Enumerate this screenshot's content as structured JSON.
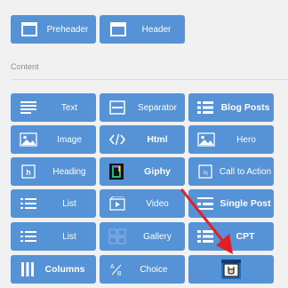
{
  "top_blocks": [
    {
      "label": "Preheader",
      "icon": "panel-icon"
    },
    {
      "label": "Header",
      "icon": "header-panel-icon"
    }
  ],
  "section": {
    "title": "Content"
  },
  "blocks": [
    {
      "label": "Text",
      "icon": "text-lines-icon"
    },
    {
      "label": "Separator",
      "icon": "separator-icon"
    },
    {
      "label": "Blog Posts",
      "icon": "blog-posts-icon"
    },
    {
      "label": "Image",
      "icon": "image-icon"
    },
    {
      "label": "Html",
      "icon": "code-icon"
    },
    {
      "label": "Hero",
      "icon": "hero-image-icon"
    },
    {
      "label": "Heading",
      "icon": "heading-icon"
    },
    {
      "label": "Giphy",
      "icon": "giphy-icon"
    },
    {
      "label": "Call to Action",
      "icon": "call-to-action-icon"
    },
    {
      "label": "List",
      "icon": "list-icon"
    },
    {
      "label": "Video",
      "icon": "video-icon"
    },
    {
      "label": "Single Post",
      "icon": "single-post-icon"
    },
    {
      "label": "List",
      "icon": "list-icon"
    },
    {
      "label": "Gallery",
      "icon": "gallery-icon"
    },
    {
      "label": "CPT",
      "icon": "cpt-icon"
    },
    {
      "label": "Columns",
      "icon": "columns-icon"
    },
    {
      "label": "Choice",
      "icon": "choice-ab-icon"
    },
    {
      "label": "",
      "icon": "custom-plugin-icon"
    }
  ],
  "colors": {
    "block": "#5592d6",
    "background": "#f1f1f1",
    "arrow": "#e41e25"
  }
}
